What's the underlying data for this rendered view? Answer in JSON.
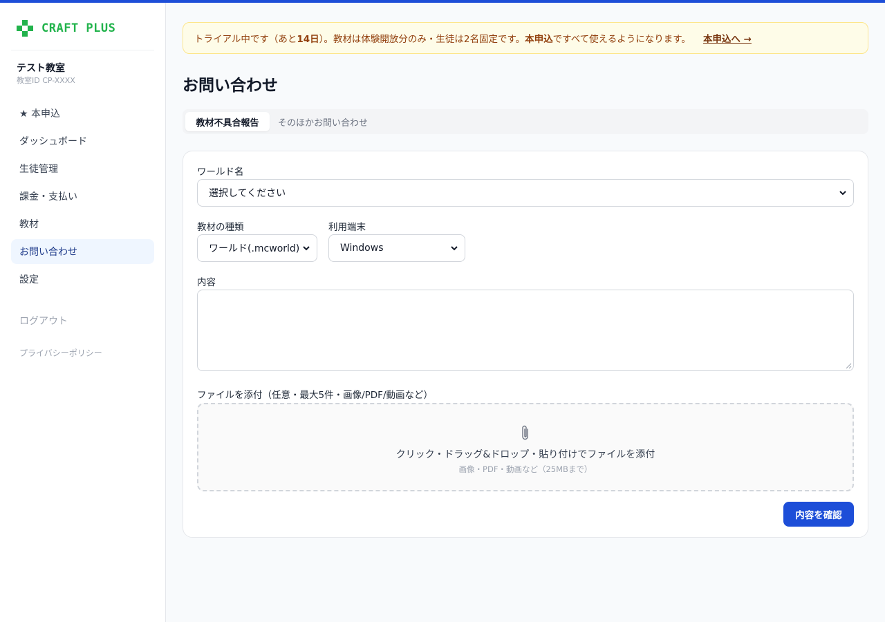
{
  "brand": {
    "name": "CRAFT PLUS",
    "color": "#22b34c",
    "icon": "plus-icon"
  },
  "school": {
    "name": "テスト教室",
    "id": "教室ID CP-XXXX"
  },
  "sidebar": {
    "items": [
      {
        "label": "★ 本申込"
      },
      {
        "label": "ダッシュボード"
      },
      {
        "label": "生徒管理"
      },
      {
        "label": "課金・支払い"
      },
      {
        "label": "教材"
      },
      {
        "label": "お問い合わせ",
        "active": true
      },
      {
        "label": "設定"
      }
    ],
    "logout": "ログアウト",
    "privacy": "プライバシーポリシー"
  },
  "banner": {
    "text_1": "トライアル中です（あと ",
    "days": "14日",
    "text_2": "）。教材は体験開放分のみ・生徒は2名固定です。",
    "bold": "本申込",
    "text_3": "ですべて使えるようになります。",
    "cta": "本申込へ →"
  },
  "page": {
    "title": "お問い合わせ"
  },
  "tabs": [
    {
      "label": "教材不具合報告",
      "active": true
    },
    {
      "label": "そのほかお問い合わせ",
      "active": false
    }
  ],
  "form": {
    "world_label": "ワールド名",
    "world_value": "選択してください",
    "material_label": "教材の種類",
    "material_value": "ワールド(.mcworld)",
    "device_label": "利用端末",
    "device_value": "Windows",
    "content_label": "内容",
    "attach_label": "ファイルを添付（任意・最大5件・画像/PDF/動画など）",
    "dropzone_main": "クリック・ドラッグ&ドロップ・貼り付けでファイルを添付",
    "dropzone_sub": "画像・PDF・動画など（25MBまで）",
    "dropzone_icon": "paperclip-icon",
    "submit": "内容を確認"
  },
  "colors": {
    "accent": "#1d4ed8",
    "banner_bg": "#fefce8",
    "banner_text": "#92400e"
  }
}
